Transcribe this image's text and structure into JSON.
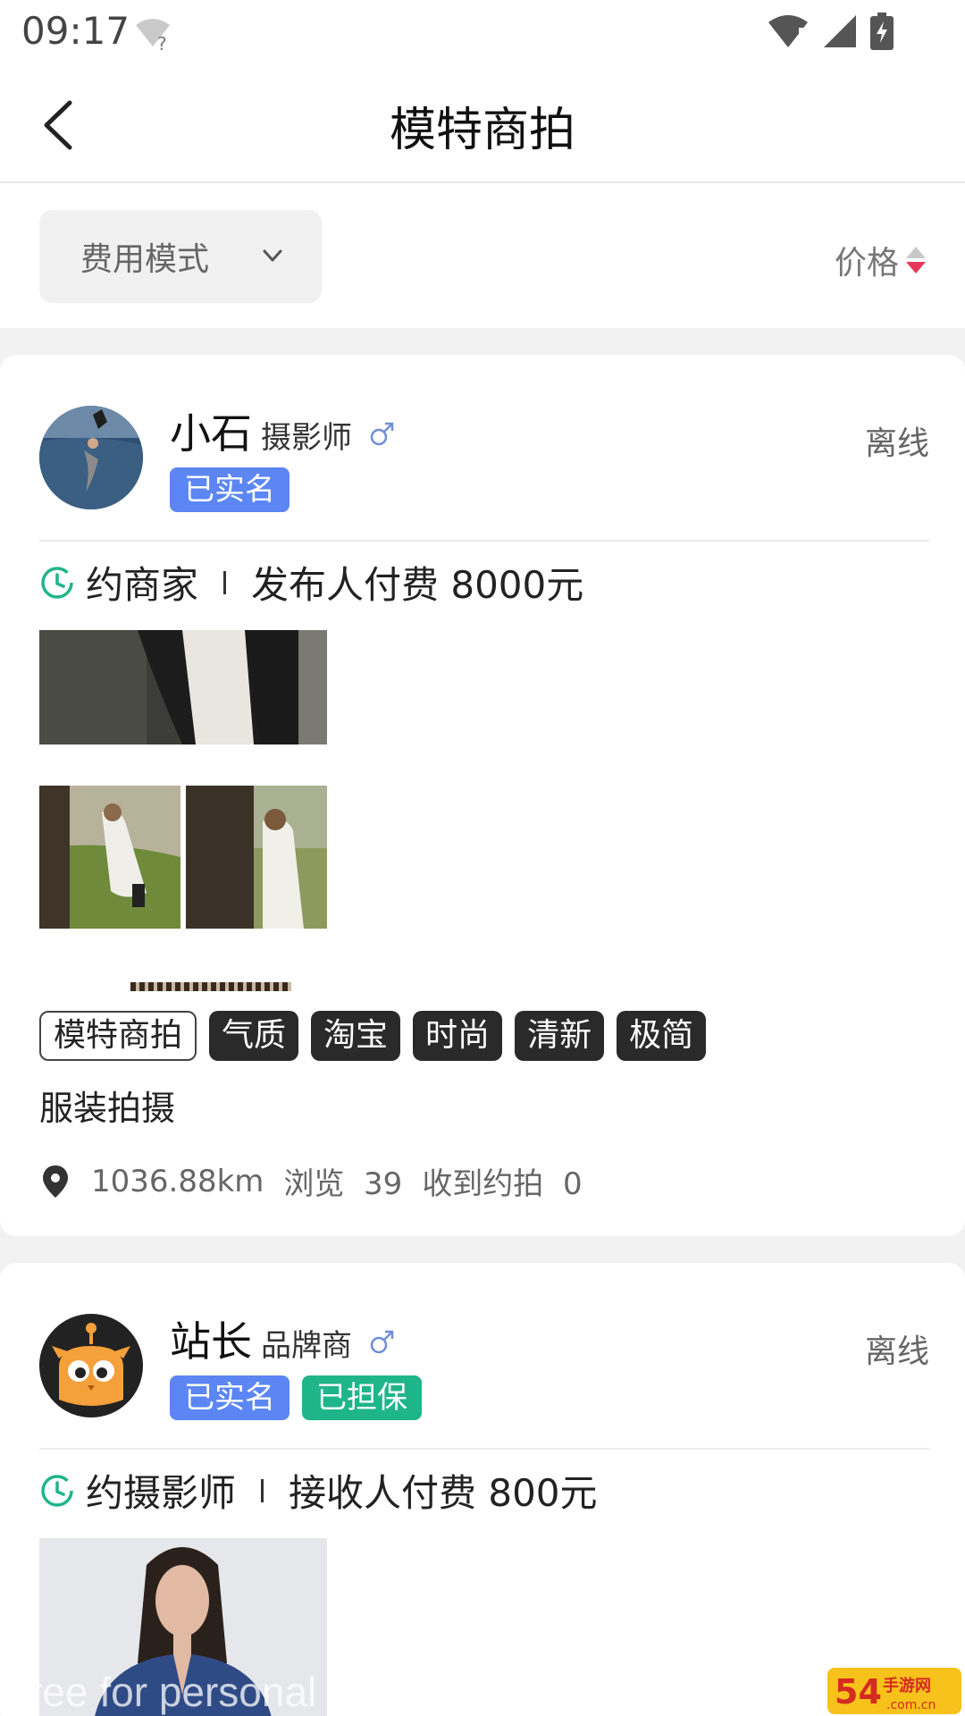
{
  "status_bar": {
    "time": "09:17",
    "wifi_icon": "wifi-unknown-icon",
    "signal_icon": "signal-icon",
    "battery_icon": "battery-charging-icon"
  },
  "header": {
    "title": "模特商拍",
    "back_icon": "chevron-left-icon"
  },
  "filters": {
    "fee_mode": "费用模式",
    "price": "价格"
  },
  "posts": [
    {
      "name": "小石",
      "role": "摄影师",
      "status": "离线",
      "badges": [
        "已实名"
      ],
      "order_type": "约商家",
      "payment": "发布人付费 8000元",
      "tags": [
        "模特商拍",
        "气质",
        "淘宝",
        "时尚",
        "清新",
        "极简"
      ],
      "description": "服装拍摄",
      "distance": "1036.88km",
      "views_label": "浏览",
      "views": "39",
      "received_label": "收到约拍",
      "received": "0"
    },
    {
      "name": "站长",
      "role": "品牌商",
      "status": "离线",
      "badges": [
        "已实名",
        "已担保"
      ],
      "order_type": "约摄影师",
      "payment": "接收人付费 800元"
    }
  ],
  "colors": {
    "accent_blue": "#5b86f3",
    "accent_green": "#1fb58a",
    "sort_red": "#e8375a"
  },
  "watermark": "Free for personal use"
}
